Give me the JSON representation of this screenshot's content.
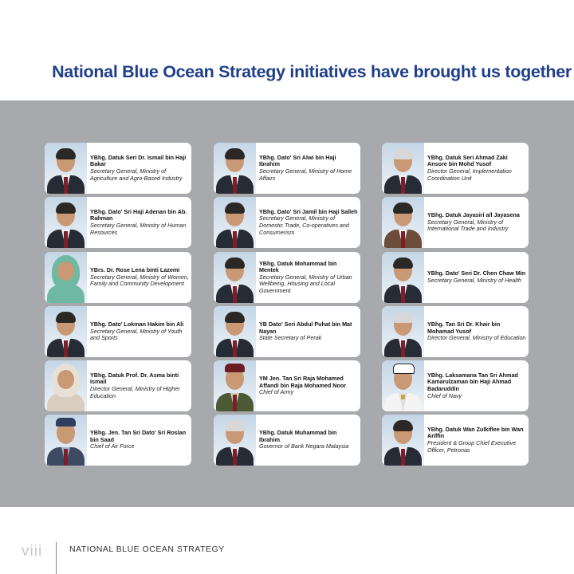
{
  "headline": "National Blue Ocean Strategy initiatives have brought us together",
  "footer": {
    "page_number": "viii",
    "title": "NATIONAL BLUE OCEAN STRATEGY"
  },
  "columns": [
    [
      {
        "name": "YBhg. Datuk Seri Dr. Ismail bin Haji Bakar",
        "role": "Secretary General, Ministry of Agriculture and Agro-Based Industry"
      },
      {
        "name": "YBhg. Dato' Sri Haji Adenan bin Ab. Rahman",
        "role": "Secretary General, Ministry of Human Resources"
      },
      {
        "name": "YBrs. Dr. Rose Lena binti Lazemi",
        "role": "Secretary General, Ministry of Women, Family and Community Development"
      },
      {
        "name": "YBhg. Dato' Lokman Hakim bin Ali",
        "role": "Secretary General, Ministry of Youth and Sports"
      },
      {
        "name": "YBhg. Datuk Prof. Dr. Asma binti Ismail",
        "role": "Director General, Ministry of Higher Education"
      },
      {
        "name": "YBhg. Jen. Tan Sri Dato' Sri Roslan bin Saad",
        "role": "Chief of Air Force"
      }
    ],
    [
      {
        "name": "YBhg. Dato' Sri Alwi bin Haji Ibrahim",
        "role": "Secretary General, Ministry of Home Affairs"
      },
      {
        "name": "YBhg. Dato' Sri Jamil bin Haji Salleh",
        "role": "Secretary General, Ministry of Domestic Trade, Co-operatives and Consumerism"
      },
      {
        "name": "YBhg. Datuk Mohammad bin Mentek",
        "role": "Secretary General, Ministry of Urban Wellbeing, Housing and Local Government"
      },
      {
        "name": "YB Dato' Seri Abdul Puhat bin Mat Nayan",
        "role": "State Secretary of Perak"
      },
      {
        "name": "YM Jen. Tan Sri Raja Mohamed Affandi bin Raja Mohamed Noor",
        "role": "Chief of Army"
      },
      {
        "name": "YBhg. Datuk Muhammad bin Ibrahim",
        "role": "Governor of Bank Negara Malaysia"
      }
    ],
    [
      {
        "name": "YBhg. Datuk Seri Ahmad Zaki Ansore bin Mohd Yusof",
        "role": "Director General, Implementation Coordination Unit"
      },
      {
        "name": "YBhg. Datuk Jayasiri a/l Jayasena",
        "role": "Secretary General, Ministry of International Trade and Industry"
      },
      {
        "name": "YBhg. Dato' Seri Dr. Chen Chaw Min",
        "role": "Secretary General, Ministry of Health"
      },
      {
        "name": "YBhg. Tan Sri Dr. Khair bin Mohamad Yusof",
        "role": "Director General, Ministry of Education"
      },
      {
        "name": "YBhg. Laksamana Tan Sri Ahmad Kamarulzaman bin Haji Ahmad Badaruddin",
        "role": "Chief of Navy"
      },
      {
        "name": "YBhg. Datuk Wan Zulkiflee bin Wan Ariffin",
        "role": "President & Group Chief Executive Officer, Petronas"
      }
    ]
  ]
}
